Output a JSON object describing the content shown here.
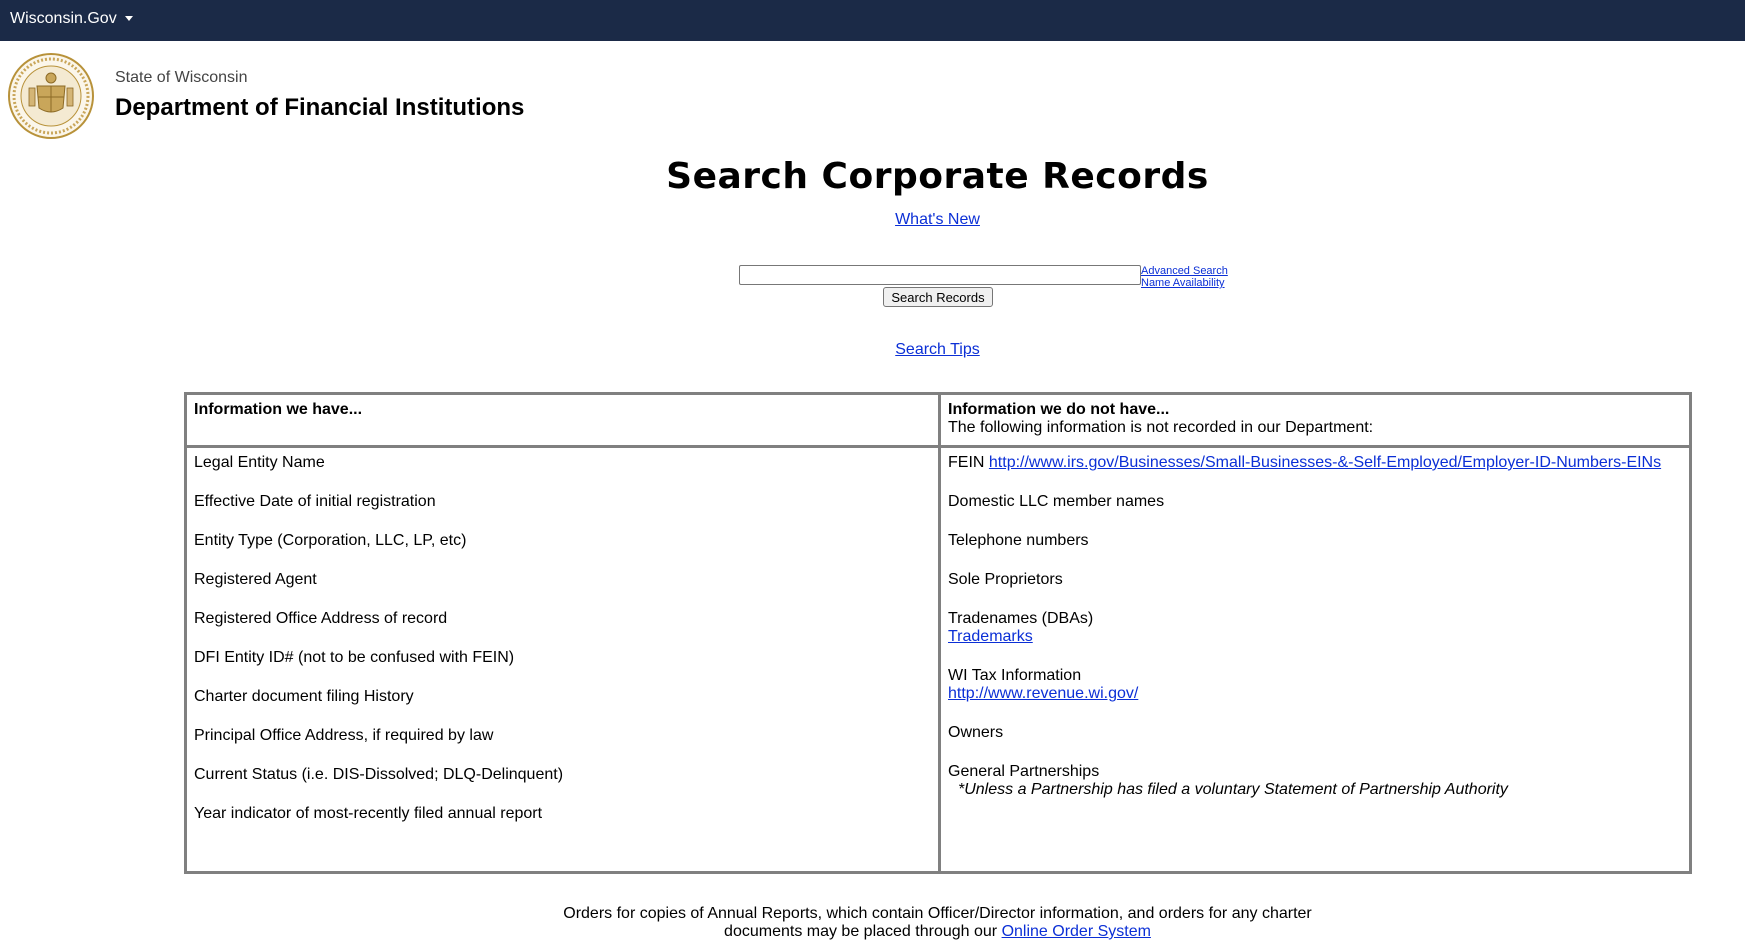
{
  "topbar": {
    "brand_label": "Wisconsin.Gov"
  },
  "agency": {
    "state": "State of Wisconsin",
    "department": "Department of Financial Institutions"
  },
  "search": {
    "title": "Search Corporate Records",
    "whats_new": "What's New",
    "input_value": "",
    "button_label": "Search Records",
    "advanced_search": "Advanced Search",
    "name_availability": "Name Availability",
    "search_tips": "Search Tips"
  },
  "table": {
    "have_header": "Information we have...",
    "not_have_header": "Information we do not have...",
    "not_have_subheader": "The following information is not recorded in our Department:",
    "have_items": [
      "Legal Entity Name",
      "Effective Date of initial registration",
      "Entity Type (Corporation, LLC, LP, etc)",
      "Registered Agent",
      "Registered Office Address of record",
      "DFI Entity ID# (not to be confused with FEIN)",
      "Charter document filing History",
      "Principal Office Address, if required by law",
      "Current Status (i.e. DIS-Dissolved; DLQ-Delinquent)",
      "Year indicator of most-recently filed annual report"
    ],
    "not_have": {
      "fein_label": "FEIN",
      "fein_link": "http://www.irs.gov/Businesses/Small-Businesses-&-Self-Employed/Employer-ID-Numbers-EINs",
      "llc_members": "Domestic LLC member names",
      "telephone": "Telephone numbers",
      "sole_props": "Sole Proprietors",
      "tradenames": "Tradenames (DBAs)",
      "trademarks_link": "Trademarks",
      "wi_tax": "WI Tax Information",
      "revenue_link": "http://www.revenue.wi.gov/",
      "owners": "Owners",
      "general_partnerships": "General Partnerships",
      "partnership_note": "*Unless a Partnership has filed a voluntary Statement of Partnership Authority"
    }
  },
  "footer": {
    "line1": "Orders for copies of Annual Reports, which contain Officer/Director information, and orders for any charter",
    "line2_prefix": "documents may be placed through our",
    "order_link": "Online Order System"
  },
  "icons": {
    "seal": "state-seal-icon",
    "caret": "caret-down-icon"
  },
  "colors": {
    "topbar": "#1b2a47",
    "link": "#0b2fd6",
    "seal_gold": "#b8923a"
  }
}
